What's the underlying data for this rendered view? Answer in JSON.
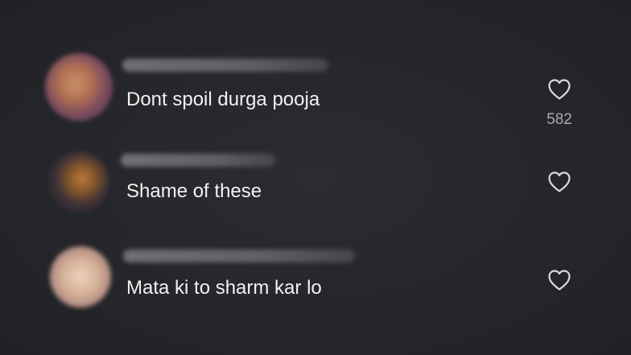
{
  "comments": [
    {
      "text": "Dont spoil durga pooja",
      "like_count": "582",
      "like_icon": "heart-outline-icon",
      "avatar_colors": [
        "#c08860",
        "#6e3f5a",
        "#b06a3a"
      ]
    },
    {
      "text": "Shame of these",
      "like_count": "",
      "like_icon": "heart-outline-icon",
      "avatar_colors": [
        "#8a5a2a",
        "#2e2a32",
        "#c07030"
      ]
    },
    {
      "text": "Mata ki to sharm kar lo",
      "like_count": "",
      "like_icon": "heart-outline-icon",
      "avatar_colors": [
        "#e6c9b0",
        "#c89c80",
        "#9a7a70"
      ]
    }
  ],
  "colors": {
    "background": "#25272b",
    "text": "#f1f1f1",
    "like_count": "#a9abb0",
    "icon": "#dadbdd"
  }
}
